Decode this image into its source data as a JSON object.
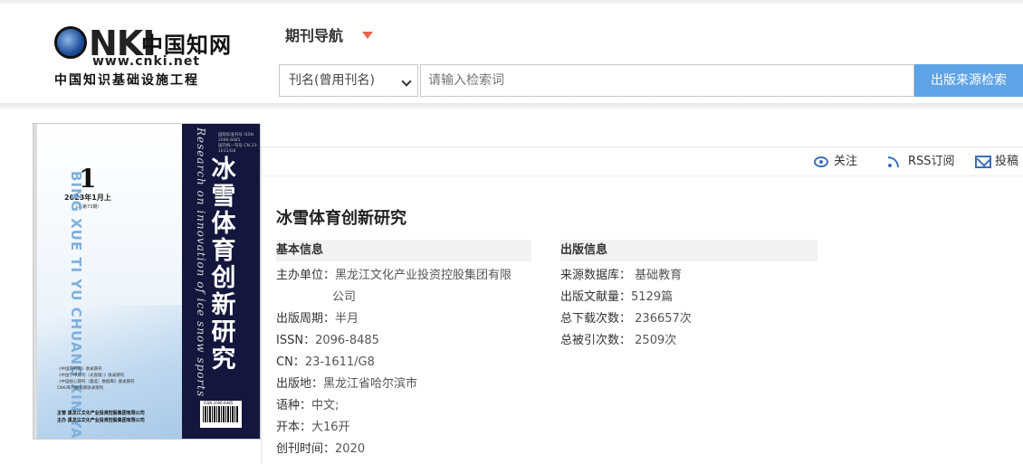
{
  "header": {
    "logo": {
      "main": "CNKI",
      "cn": "中国知网",
      "url": "www.cnki.net",
      "sub": "中国知识基础设施工程"
    },
    "nav_title": "期刊导航",
    "search": {
      "select_value": "刊名(曾用刊名)",
      "placeholder": "请输入检索词",
      "button_label": "出版来源检索"
    }
  },
  "cover": {
    "issue_number": "1",
    "issue_date": "2023年1月上",
    "issue_total": "（总第73期）",
    "pinyin": "BING XUE TI YU CHUANG XIN YAN JIU",
    "english_title": "Research on innovation of ice snow sports",
    "chinese_title": "冰雪体育创新研究",
    "meta_line1": "国际标准刊号  ISSN 2096-8485",
    "meta_line2": "国内统一刊号  CN 23-1611/G8",
    "index_list": [
      "《中国期刊网》收录期刊",
      "《中国学术期刊（光盘版）》收录期刊",
      "《中国核心期刊（遴选）数据库》收录期刊",
      "CNKI系列数据库收录期刊"
    ],
    "publisher_line1": "主管  黑龙江文化产业投资控股集团有限公司",
    "publisher_line2": "主办  黑龙江文化产业投资控股集团有限公司",
    "barcode_text": "ISSN 2096-8485"
  },
  "toolbar": {
    "follow_label": "关注",
    "follow_icon": "eye-icon",
    "rss_label": "RSS订阅",
    "rss_icon": "rss-icon",
    "submit_label": "投稿",
    "submit_icon": "mail-icon"
  },
  "journal": {
    "title": "冰雪体育创新研究",
    "basic_info": {
      "heading": "基本信息",
      "sponsor_key": "主办单位：",
      "sponsor_value_line1": "黑龙江文化产业投资控股集团有限",
      "sponsor_value_line2": "公司",
      "cycle_key": "出版周期：",
      "cycle_value": "半月",
      "issn_key": "ISSN：",
      "issn_value": "2096-8485",
      "cn_key": "CN：",
      "cn_value": "23-1611/G8",
      "place_key": "出版地：",
      "place_value": "黑龙江省哈尔滨市",
      "lang_key": "语种：",
      "lang_value": "中文;",
      "format_key": "开本：",
      "format_value": "大16开",
      "founded_key": "创刊时间：",
      "founded_value": "2020"
    },
    "pub_info": {
      "heading": "出版信息",
      "db_key": "来源数据库：",
      "db_value": "基础教育",
      "count_key": "出版文献量：",
      "count_value": "5129篇",
      "downloads_key": "总下载次数：",
      "downloads_value": "236657次",
      "citations_key": "总被引次数：",
      "citations_value": "2509次"
    }
  },
  "colors": {
    "accent_blue": "#5ea3e6",
    "icon_blue": "#3b6fb6",
    "caret_orange": "#e8674a",
    "cover_navy": "#14163d"
  }
}
